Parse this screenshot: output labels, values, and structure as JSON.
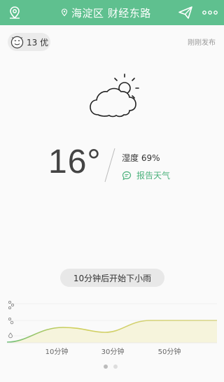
{
  "header": {
    "title": "海淀区 财经东路",
    "bg_color": "#5fc08f"
  },
  "aqi": {
    "value": "13 优",
    "face_icon": "smiley-face-icon"
  },
  "published": "刚刚发布",
  "current": {
    "condition_icon": "partly-cloudy-icon",
    "temperature": "16°",
    "humidity": "湿度 69%",
    "report_label": "报告天气"
  },
  "forecast": {
    "summary": "10分钟后开始下小雨"
  },
  "chart_data": {
    "type": "area",
    "x_tick_labels": [
      "10分钟",
      "30分钟",
      "50分钟"
    ],
    "y_levels": [
      "light-rain",
      "moderate-rain",
      "heavy-rain"
    ],
    "colors": {
      "line": "#cfcf5a",
      "line_start": "#6fbf7a",
      "fill": "#f5f3d8"
    }
  },
  "pager": {
    "pages": 2,
    "active": 0
  }
}
